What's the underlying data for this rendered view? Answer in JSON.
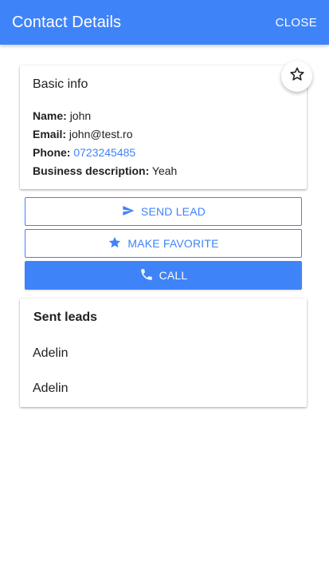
{
  "appbar": {
    "title": "Contact Details",
    "close_label": "CLOSE"
  },
  "basic_info": {
    "title": "Basic info",
    "name_label": "Name:",
    "name": "john",
    "email_label": "Email:",
    "email": "john@test.ro",
    "phone_label": "Phone:",
    "phone": "0723245485",
    "business_label": "Business description:",
    "business": "Yeah"
  },
  "favorite_fab": {
    "icon": "star-outline-icon"
  },
  "actions": {
    "send_lead": {
      "label": "SEND LEAD",
      "icon": "send-icon"
    },
    "make_favorite": {
      "label": "MAKE FAVORITE",
      "icon": "star-icon"
    },
    "call": {
      "label": "CALL",
      "icon": "phone-icon"
    }
  },
  "sent_leads": {
    "title": "Sent leads",
    "items": [
      "Adelin",
      "Adelin"
    ]
  },
  "colors": {
    "primary": "#3f83f8",
    "text": "#212121",
    "surface": "#ffffff"
  }
}
